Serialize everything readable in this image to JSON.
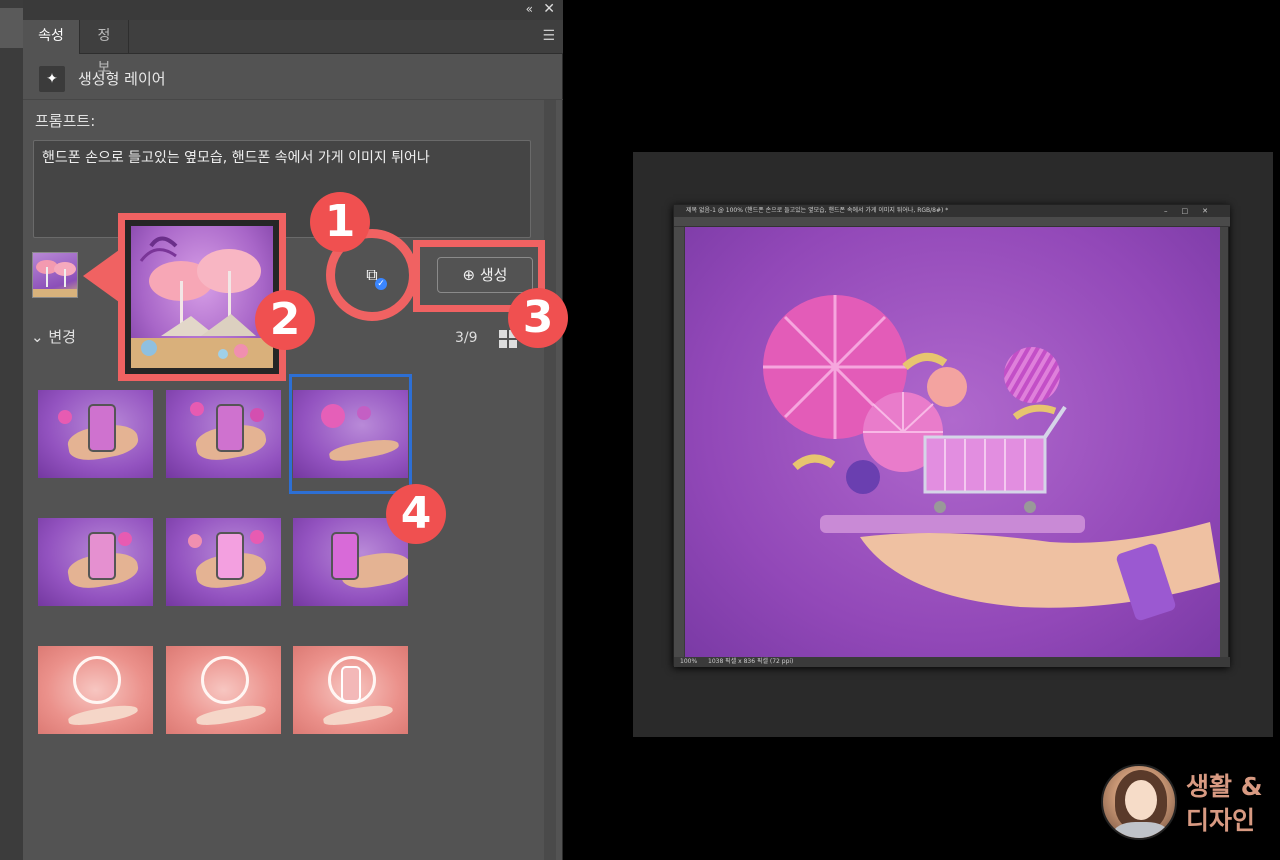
{
  "panel": {
    "collapse_icon": "double-chevron-left-icon",
    "close_icon": "close-icon",
    "tabs": [
      {
        "label": "속성",
        "active": true
      },
      {
        "label": "정보",
        "active": false
      }
    ],
    "menu_icon": "hamburger-menu-icon",
    "layer_type_icon": "generative-sparkle-icon",
    "layer_title": "생성형 레이어",
    "prompt_label": "프롬프트:",
    "prompt_value": "핸드폰 손으로 들고있는 옆모습, 핸드폰 속에서 가게 이미지 튀어나",
    "reference_image_icon": "reference-image-icon",
    "generate_button_label": "생성",
    "variations_label": "변경",
    "variations_count": "3/9",
    "selected_variation_index": 2,
    "variation_count_total": 9
  },
  "annotations": {
    "badge_1": "1",
    "badge_2": "2",
    "badge_3": "3",
    "badge_4": "4",
    "accent_color": "#f06262",
    "selection_color": "#2d6fd4"
  },
  "document": {
    "title": "제목 없음-1 @ 100% (핸드폰 손으로 들고있는 옆모습, 핸드폰 속에서 가게 이미지 튀어나, RGB/8#) *",
    "zoom": "100%",
    "status_info": "1038 픽셀 x 836 픽셀 (72 ppi)"
  },
  "brand": {
    "line1": "생활 &",
    "line2": "디자인"
  }
}
